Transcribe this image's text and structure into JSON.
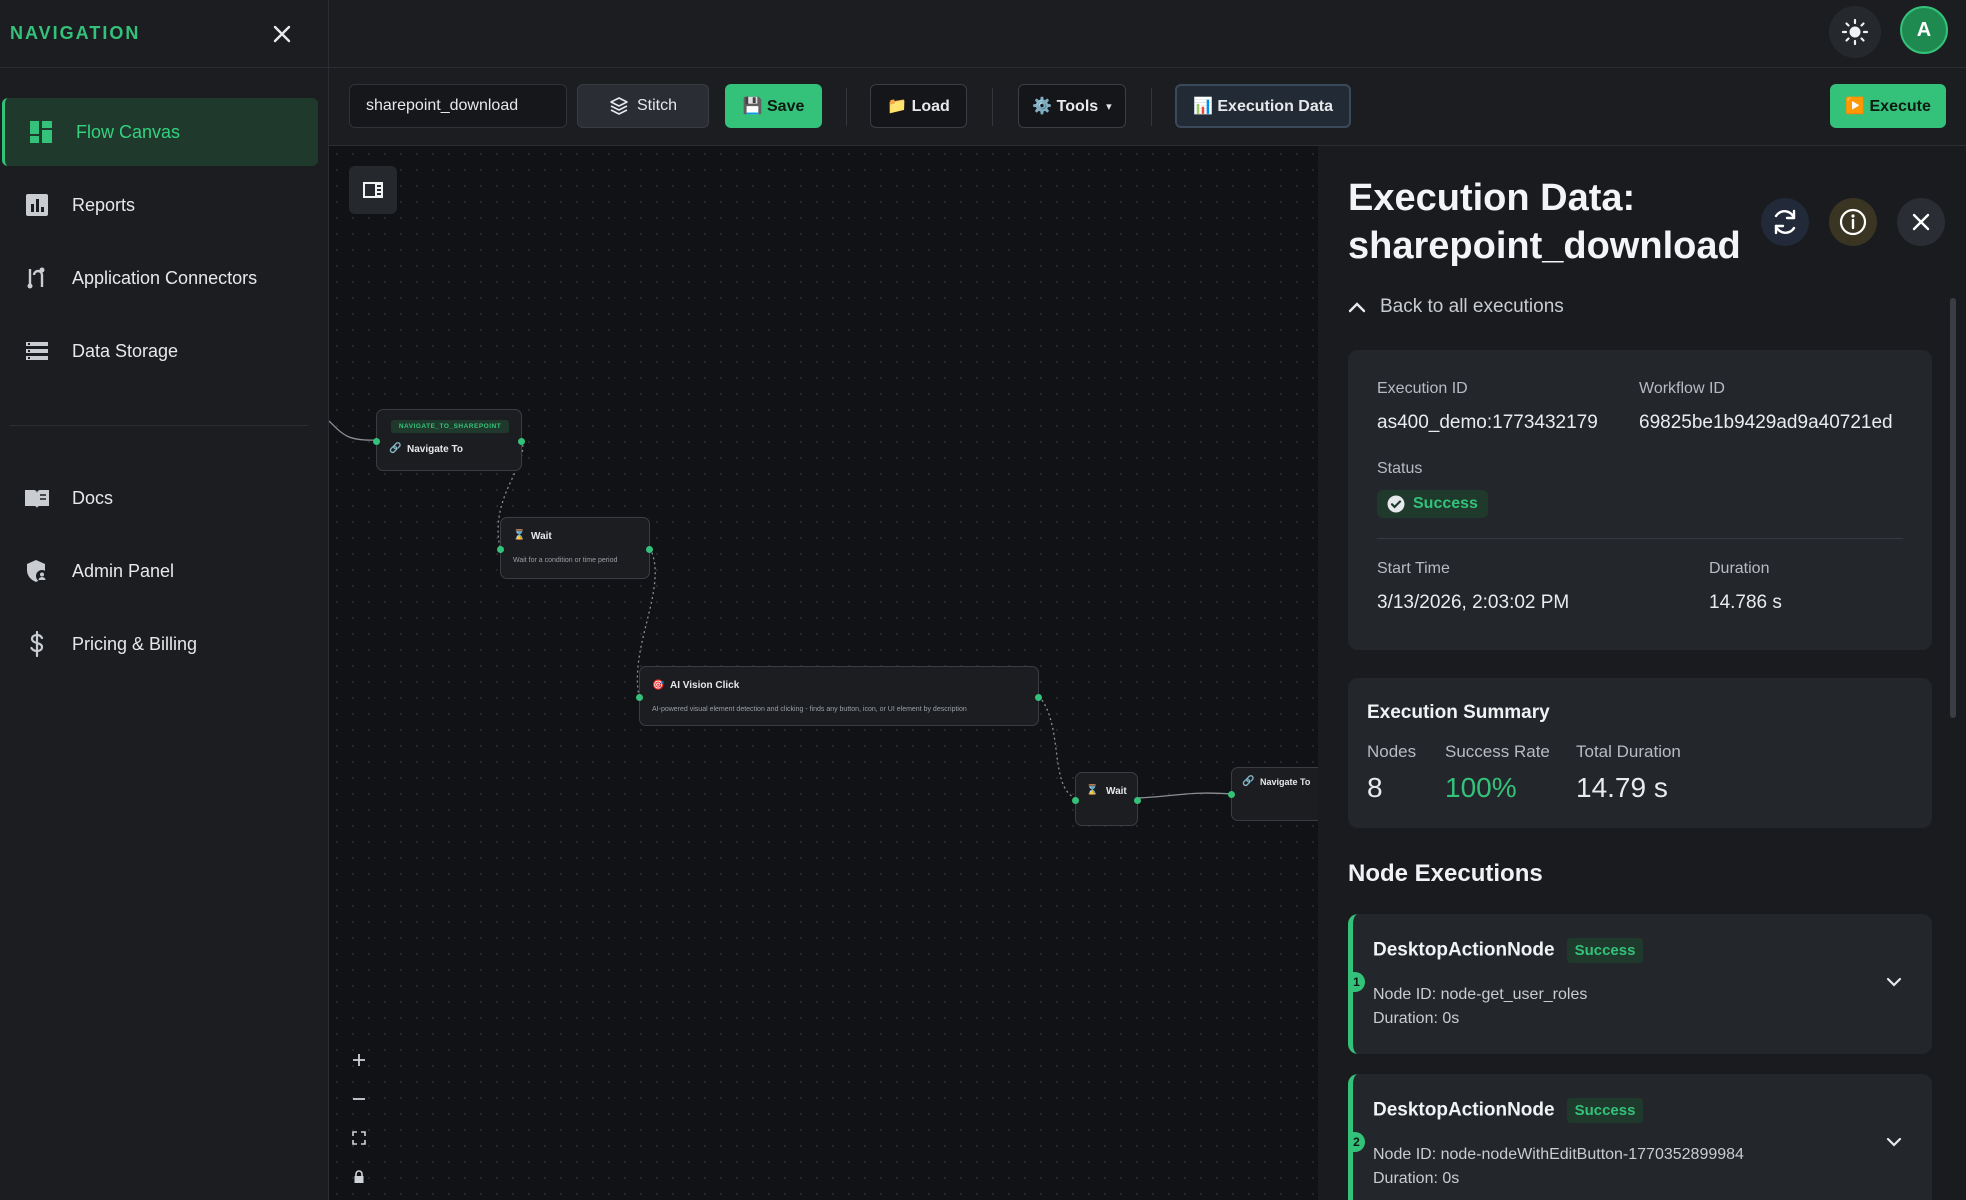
{
  "nav": {
    "title": "NAVIGATION",
    "items": [
      {
        "label": "Flow Canvas",
        "icon": "dashboard-icon"
      },
      {
        "label": "Reports",
        "icon": "bar-chart-icon"
      },
      {
        "label": "Application Connectors",
        "icon": "connector-icon"
      },
      {
        "label": "Data Storage",
        "icon": "storage-icon"
      }
    ],
    "items2": [
      {
        "label": "Docs",
        "icon": "book-icon"
      },
      {
        "label": "Admin Panel",
        "icon": "admin-shield-icon"
      },
      {
        "label": "Pricing & Billing",
        "icon": "dollar-icon"
      }
    ]
  },
  "header": {
    "avatar_initial": "A"
  },
  "toolbar": {
    "workflow_name": "sharepoint_download",
    "stitch": "Stitch",
    "save": "💾 Save",
    "load": "📁 Load",
    "tools": "⚙️ Tools",
    "tools_caret": "▾",
    "execution_data": "📊 Execution Data",
    "execute": "▶️ Execute"
  },
  "canvas": {
    "nodes": {
      "navigate1_tag": "NAVIGATE_TO_SHAREPOINT",
      "navigate1_title": "Navigate To",
      "wait1_title": "Wait",
      "wait1_desc": "Wait for a condition or time period",
      "vision_title": "AI Vision Click",
      "vision_desc": "AI-powered visual element detection and clicking - finds any button, icon, or UI element by description",
      "wait2_title": "Wait",
      "navigate2_title": "Navigate To"
    }
  },
  "panel": {
    "title": "Execution Data: sharepoint_download",
    "back": "Back to all executions",
    "execution_id_label": "Execution ID",
    "execution_id": "as400_demo:1773432179",
    "workflow_id_label": "Workflow ID",
    "workflow_id": "69825be1b9429ad9a40721ed",
    "status_label": "Status",
    "status": "Success",
    "start_time_label": "Start Time",
    "start_time": "3/13/2026, 2:03:02 PM",
    "duration_label": "Duration",
    "duration": "14.786 s",
    "summary": {
      "title": "Execution Summary",
      "nodes_label": "Nodes",
      "nodes": "8",
      "success_rate_label": "Success Rate",
      "success_rate": "100%",
      "total_duration_label": "Total Duration",
      "total_duration": "14.79 s"
    },
    "node_executions_title": "Node Executions",
    "node_executions": [
      {
        "num": "1",
        "name": "DesktopActionNode",
        "status": "Success",
        "node_id": "Node ID: node-get_user_roles",
        "duration": "Duration: 0s"
      },
      {
        "num": "2",
        "name": "DesktopActionNode",
        "status": "Success",
        "node_id": "Node ID: node-nodeWithEditButton-1770352899984",
        "duration": "Duration: 0s"
      }
    ]
  },
  "colors": {
    "accent": "#34c27a",
    "bg": "#16181c",
    "card": "#23262b"
  }
}
